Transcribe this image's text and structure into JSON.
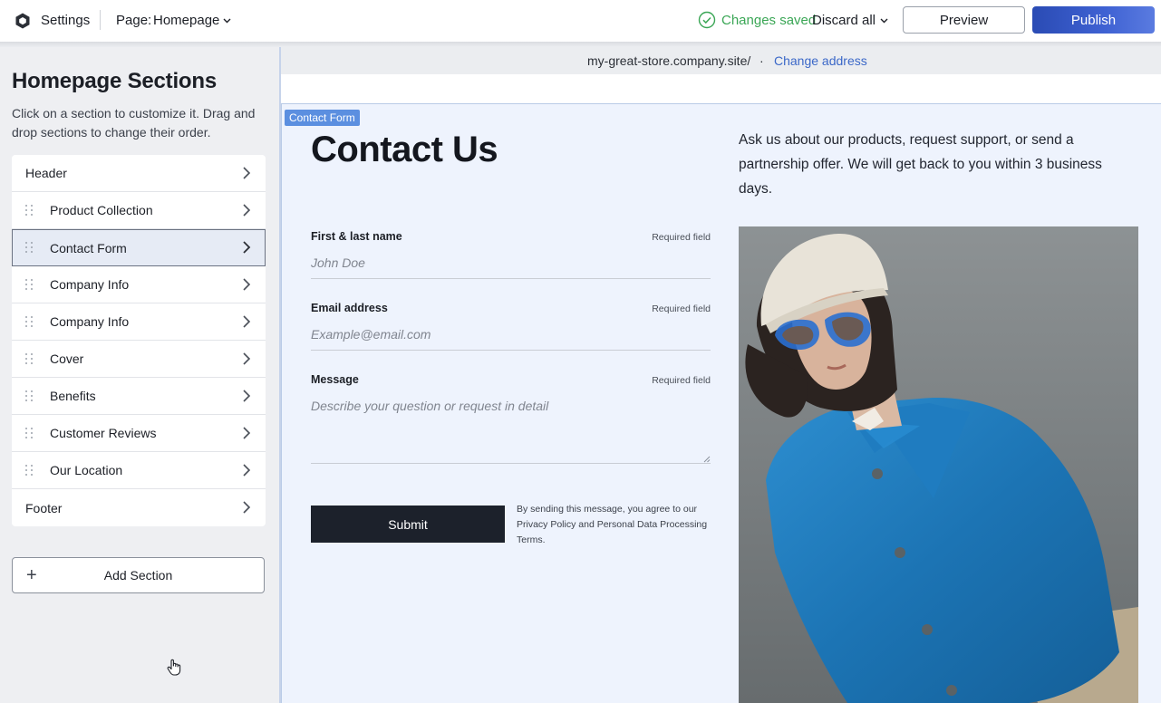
{
  "topbar": {
    "settings_label": "Settings",
    "page_label": "Page:",
    "page_value": "Homepage",
    "status": "Changes saved",
    "discard_label": "Discard all",
    "preview_label": "Preview",
    "publish_label": "Publish"
  },
  "sidebar": {
    "title": "Homepage Sections",
    "description": "Click on a section to customize it. Drag and drop sections to change their order.",
    "sections": [
      {
        "label": "Header",
        "draggable": false,
        "selected": false
      },
      {
        "label": "Product Collection",
        "draggable": true,
        "selected": false
      },
      {
        "label": "Contact Form",
        "draggable": true,
        "selected": true
      },
      {
        "label": "Company Info",
        "draggable": true,
        "selected": false
      },
      {
        "label": "Company Info",
        "draggable": true,
        "selected": false
      },
      {
        "label": "Cover",
        "draggable": true,
        "selected": false
      },
      {
        "label": "Benefits",
        "draggable": true,
        "selected": false
      },
      {
        "label": "Customer Reviews",
        "draggable": true,
        "selected": false
      },
      {
        "label": "Our Location",
        "draggable": true,
        "selected": false
      },
      {
        "label": "Footer",
        "draggable": false,
        "selected": false
      }
    ],
    "add_section_label": "Add Section"
  },
  "preview": {
    "address": "my-great-store.company.site/",
    "address_separator": "·",
    "change_address_label": "Change address",
    "section_tag": "Contact Form",
    "title": "Contact Us",
    "description": "Ask us about our products, request support, or send a partnership offer. We will get back to you within 3 business days.",
    "fields": [
      {
        "label": "First & last name",
        "required": "Required field",
        "placeholder": "John Doe"
      },
      {
        "label": "Email address",
        "required": "Required field",
        "placeholder": "Example@email.com"
      },
      {
        "label": "Message",
        "required": "Required field",
        "placeholder": "Describe your question or request in detail"
      }
    ],
    "submit_label": "Submit",
    "legal_text": "By sending this message, you agree to our Privacy Policy and Personal Data Processing Terms."
  },
  "colors": {
    "accent": "#3f62d3",
    "success": "#3aa655",
    "link": "#3b68c8",
    "section_bg": "#eef3fd"
  }
}
